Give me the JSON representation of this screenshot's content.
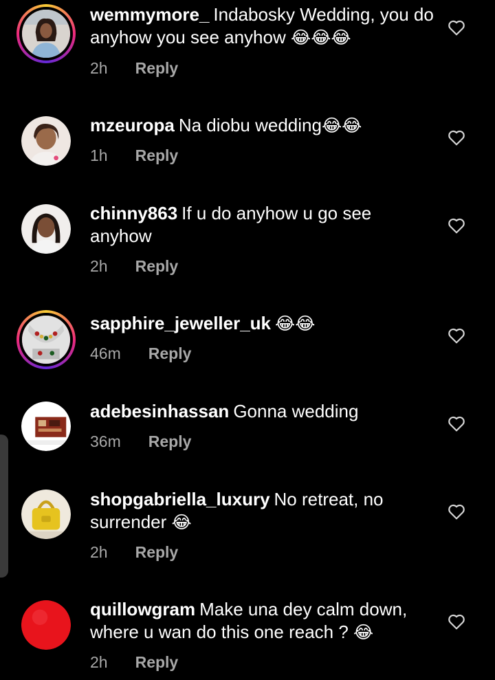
{
  "comments": [
    {
      "username": "wemmymore_",
      "text": "Indabosky Wedding, you do anyhow you see anyhow",
      "emoji": "😂😂😂",
      "time": "2h",
      "reply": "Reply"
    },
    {
      "username": "mzeuropa",
      "text": "Na diobu wedding",
      "emoji": "😂😂",
      "time": "1h",
      "reply": "Reply"
    },
    {
      "username": "chinny863",
      "text": "If u do anyhow u go see anyhow",
      "emoji": "",
      "time": "2h",
      "reply": "Reply"
    },
    {
      "username": "sapphire_jeweller_uk",
      "text": "",
      "emoji": "😂😂",
      "time": "46m",
      "reply": "Reply"
    },
    {
      "username": "adebesinhassan",
      "text": "Gonna wedding",
      "emoji": "",
      "time": "36m",
      "reply": "Reply"
    },
    {
      "username": "shopgabriella_luxury",
      "text": "No retreat, no surrender",
      "emoji": "😂",
      "time": "2h",
      "reply": "Reply"
    },
    {
      "username": "quillowgram",
      "text": "Make una dey calm down, where u wan do this one reach ?",
      "emoji": "😂",
      "time": "2h",
      "reply": "Reply"
    }
  ],
  "icons": {
    "like": "heart-outline-icon"
  },
  "colors": {
    "background": "#000000",
    "text": "#ffffff",
    "secondary": "#a8a8a8",
    "avatar_red": "#e8141c"
  }
}
